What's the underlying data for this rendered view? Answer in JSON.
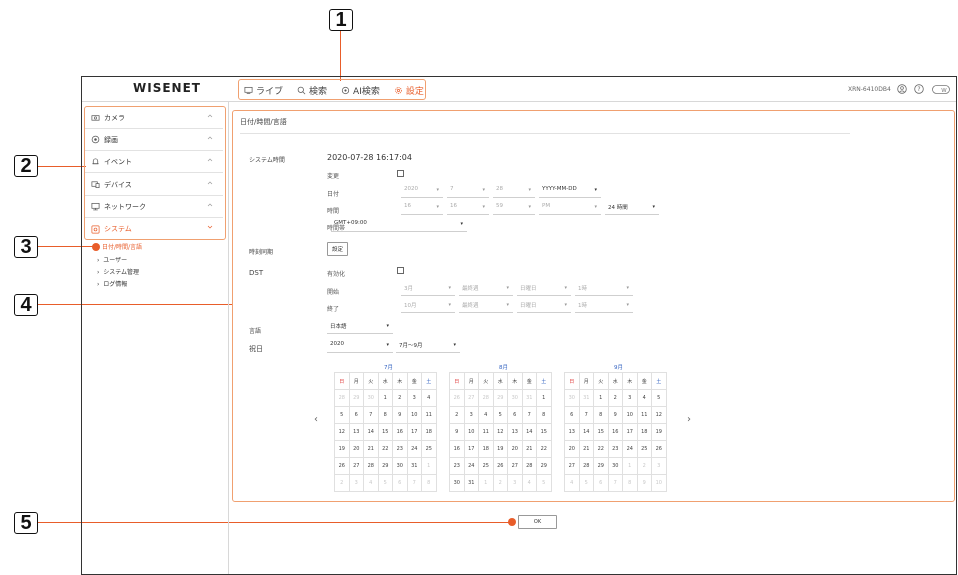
{
  "callouts": [
    "1",
    "2",
    "3",
    "4",
    "5"
  ],
  "header": {
    "logo": "WISENET",
    "nav": [
      {
        "label": "ライブ",
        "icon": "monitor-icon"
      },
      {
        "label": "検索",
        "icon": "search-icon"
      },
      {
        "label": "AI検索",
        "icon": "ai-search-icon"
      },
      {
        "label": "設定",
        "icon": "gear-icon"
      }
    ],
    "model": "XRN-6410DB4"
  },
  "sidebar": {
    "items": [
      {
        "label": "カメラ",
        "icon": "camera-icon"
      },
      {
        "label": "録画",
        "icon": "record-icon"
      },
      {
        "label": "イベント",
        "icon": "bell-icon"
      },
      {
        "label": "デバイス",
        "icon": "device-icon"
      },
      {
        "label": "ネットワーク",
        "icon": "network-icon"
      },
      {
        "label": "システム",
        "icon": "system-icon"
      }
    ],
    "subitems": [
      "日付/時間/言語",
      "ユーザー",
      "システム管理",
      "ログ情報"
    ]
  },
  "content": {
    "title": "日付/時間/言語",
    "system_time_label": "システム時間",
    "system_time_value": "2020-07-28 16:17:04",
    "change_label": "変更",
    "date_label": "日付",
    "date_fields": [
      "2020",
      "7",
      "28",
      "YYYY-MM-DD"
    ],
    "time_label": "時間",
    "time_fields": [
      "16",
      "16",
      "59",
      "PM",
      "24 時間"
    ],
    "timezone_label": "時間帯",
    "timezone_value": "GMT+09:00",
    "sync_label": "時刻同期",
    "sync_button": "設定",
    "dst_label": "DST",
    "dst_enable_label": "有効化",
    "dst_start_label": "開始",
    "dst_start_fields": [
      "3月",
      "最終週",
      "日曜日",
      "1時"
    ],
    "dst_end_label": "終了",
    "dst_end_fields": [
      "10月",
      "最終週",
      "日曜日",
      "1時"
    ],
    "language_label": "言語",
    "language_value": "日本語",
    "holiday_label": "祝日",
    "holiday_year": "2020",
    "holiday_range": "7月～9月",
    "months": [
      "7月",
      "8月",
      "9月"
    ],
    "weekdays": [
      "日",
      "月",
      "火",
      "水",
      "木",
      "金",
      "土"
    ],
    "prev": "‹",
    "next": "›",
    "cal": [
      [
        [
          "28",
          "29",
          "30",
          "1",
          "2",
          "3",
          "4"
        ],
        [
          "5",
          "6",
          "7",
          "8",
          "9",
          "10",
          "11"
        ],
        [
          "12",
          "13",
          "14",
          "15",
          "16",
          "17",
          "18"
        ],
        [
          "19",
          "20",
          "21",
          "22",
          "23",
          "24",
          "25"
        ],
        [
          "26",
          "27",
          "28",
          "29",
          "30",
          "31",
          "1"
        ],
        [
          "2",
          "3",
          "4",
          "5",
          "6",
          "7",
          "8"
        ]
      ],
      [
        [
          "26",
          "27",
          "28",
          "29",
          "30",
          "31",
          "1"
        ],
        [
          "2",
          "3",
          "4",
          "5",
          "6",
          "7",
          "8"
        ],
        [
          "9",
          "10",
          "11",
          "12",
          "13",
          "14",
          "15"
        ],
        [
          "16",
          "17",
          "18",
          "19",
          "20",
          "21",
          "22"
        ],
        [
          "23",
          "24",
          "25",
          "26",
          "27",
          "28",
          "29"
        ],
        [
          "30",
          "31",
          "1",
          "2",
          "3",
          "4",
          "5"
        ]
      ],
      [
        [
          "30",
          "31",
          "1",
          "2",
          "3",
          "4",
          "5"
        ],
        [
          "6",
          "7",
          "8",
          "9",
          "10",
          "11",
          "12"
        ],
        [
          "13",
          "14",
          "15",
          "16",
          "17",
          "18",
          "19"
        ],
        [
          "20",
          "21",
          "22",
          "23",
          "24",
          "25",
          "26"
        ],
        [
          "27",
          "28",
          "29",
          "30",
          "1",
          "2",
          "3"
        ],
        [
          "4",
          "5",
          "6",
          "7",
          "8",
          "9",
          "10"
        ]
      ]
    ],
    "ok_button": "OK"
  },
  "colors": {
    "accent": "#e85d2a",
    "highlight_border": "#f0a070"
  }
}
